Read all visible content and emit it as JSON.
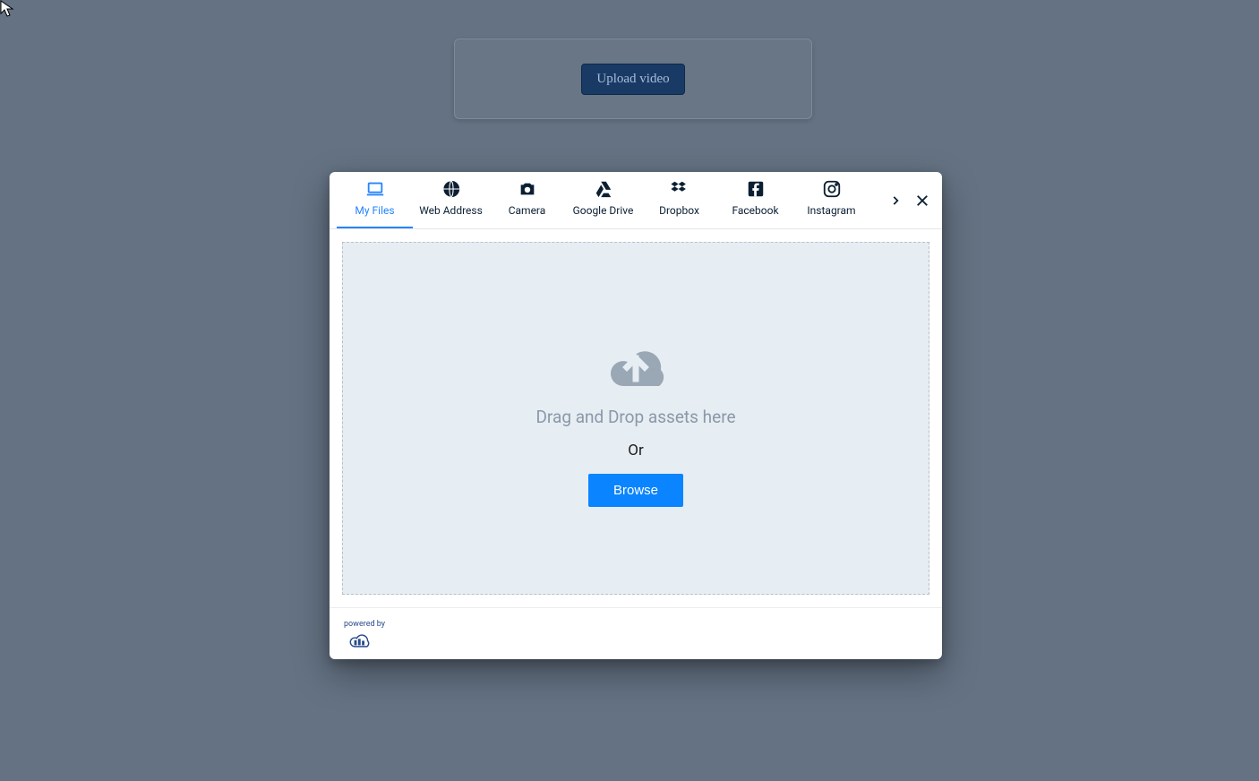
{
  "background": {
    "upload_button_label": "Upload video"
  },
  "modal": {
    "tabs": [
      {
        "label": "My Files",
        "icon": "laptop-icon",
        "active": true
      },
      {
        "label": "Web Address",
        "icon": "globe-icon",
        "active": false
      },
      {
        "label": "Camera",
        "icon": "camera-icon",
        "active": false
      },
      {
        "label": "Google Drive",
        "icon": "google-drive-icon",
        "active": false
      },
      {
        "label": "Dropbox",
        "icon": "dropbox-icon",
        "active": false
      },
      {
        "label": "Facebook",
        "icon": "facebook-icon",
        "active": false
      },
      {
        "label": "Instagram",
        "icon": "instagram-icon",
        "active": false
      }
    ],
    "dropzone": {
      "title": "Drag and Drop assets here",
      "or": "Or",
      "browse_label": "Browse"
    },
    "footer": {
      "powered_by": "powered by"
    }
  },
  "colors": {
    "background": "#748193",
    "accent": "#2684ff",
    "browse_button": "#0a84ff",
    "dropzone_bg": "#e6edf3"
  }
}
